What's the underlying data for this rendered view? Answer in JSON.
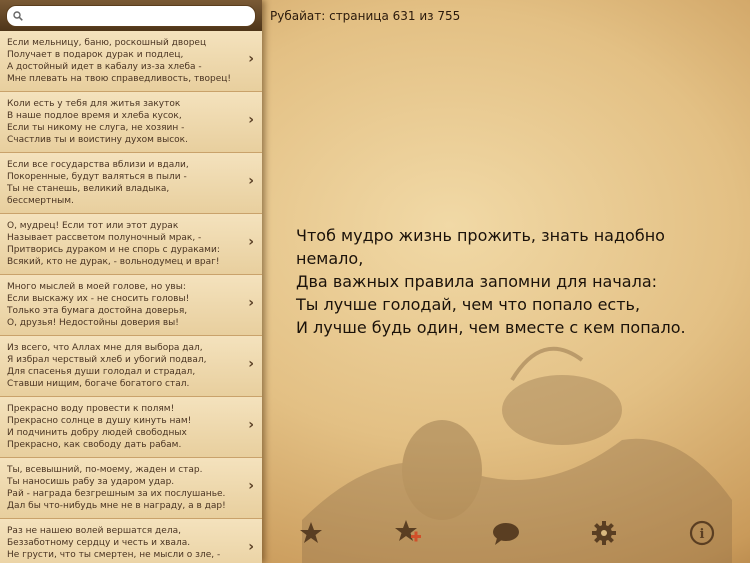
{
  "search": {
    "placeholder": ""
  },
  "header": {
    "title": "Рубайат: страница 631 из 755"
  },
  "poem": {
    "lines": [
      "Чтоб мудро жизнь прожить, знать надобно",
      "немало,",
      "Два важных правила запомни для начала:",
      "Ты лучше голодай, чем что попало есть,",
      "И лучше будь один, чем вместе с кем попало."
    ]
  },
  "sidebar": {
    "items": [
      {
        "lines": [
          "Если мельницу, баню, роскошный дворец",
          "Получает в подарок дурак и подлец,",
          "А достойный идет в кабалу из-за хлеба -",
          "Мне плевать на твою справедливость, творец!"
        ]
      },
      {
        "lines": [
          "Коли есть у тебя для житья закуток",
          "В наше подлое время и хлеба кусок,",
          "Если ты никому не слуга, не хозяин -",
          "Счастлив ты и воистину духом высок."
        ]
      },
      {
        "lines": [
          "Если все государства вблизи и вдали,",
          "Покоренные, будут валяться в пыли -",
          "Ты не станешь, великий владыка,",
          "бессмертным."
        ]
      },
      {
        "lines": [
          "О, мудрец! Если тот или этот дурак",
          "Называет рассветом полуночный мрак, -",
          "Притворись дураком и не спорь с дураками:",
          "Всякий, кто не дурак, - вольнодумец и враг!"
        ]
      },
      {
        "lines": [
          "Много мыслей в моей голове, но увы:",
          "Если выскажу их - не сносить головы!",
          "Только эта бумага достойна доверья,",
          "О, друзья! Недостойны доверия вы!"
        ]
      },
      {
        "lines": [
          "Из всего, что Аллах мне для выбора дал,",
          "Я избрал черствый хлеб и убогий подвал,",
          "Для спасенья души голодал и страдал,",
          "Ставши нищим, богаче богатого стал."
        ]
      },
      {
        "lines": [
          "Прекрасно воду провести к полям!",
          "Прекрасно солнце в душу кинуть нам!",
          "И подчинить добру людей свободных",
          "Прекрасно, как свободу дать рабам."
        ]
      },
      {
        "lines": [
          "Ты, всевышний, по-моему, жаден и стар.",
          "Ты наносишь рабу за ударом удар.",
          "Рай - награда безгрешным за их послушанье.",
          "Дал бы что-нибудь мне не в награду, а в дар!"
        ]
      },
      {
        "lines": [
          "Раз не нашею волей вершатся дела,",
          "Беззаботному сердцу и честь и хвала.",
          "Не грусти, что ты смертен, не мысли о зле, -"
        ]
      }
    ]
  },
  "toolbar": {
    "icons": [
      "star-icon",
      "star-add-icon",
      "comment-icon",
      "gear-icon",
      "info-icon"
    ],
    "colors": {
      "icon": "#5a3e22",
      "add": "#d0502a"
    }
  }
}
